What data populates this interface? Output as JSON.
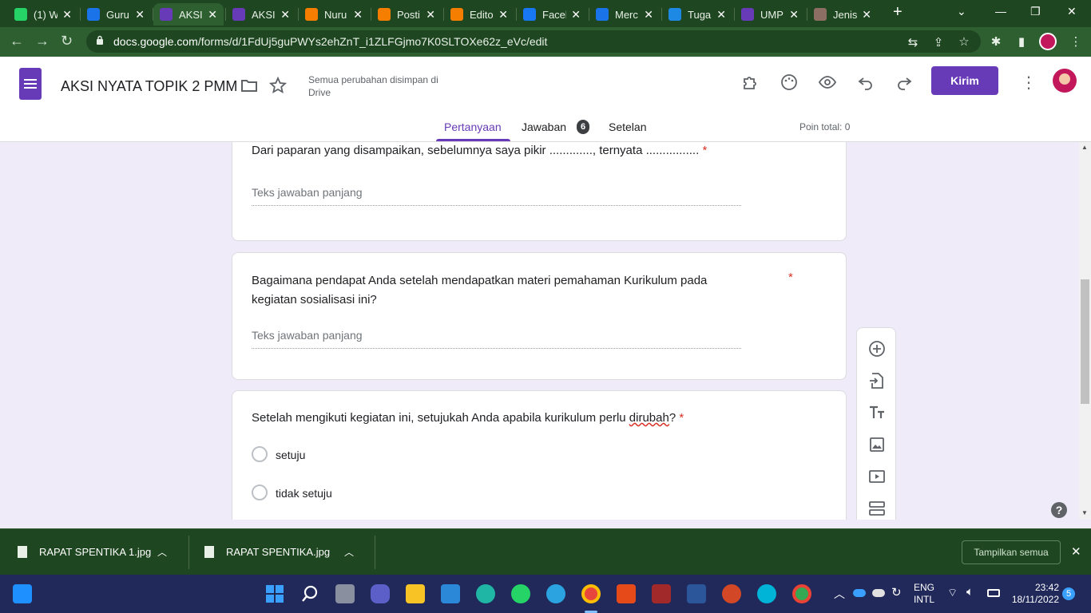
{
  "browser": {
    "tabs": [
      {
        "title": "(1) W",
        "icon": "whatsapp-icon",
        "color": "#25d366"
      },
      {
        "title": "Guru",
        "icon": "merdeka-icon",
        "color": "#1a73e8"
      },
      {
        "title": "AKSI",
        "icon": "forms-icon",
        "color": "#673ab7",
        "active": true
      },
      {
        "title": "AKSI",
        "icon": "forms-icon",
        "color": "#673ab7"
      },
      {
        "title": "Nuru",
        "icon": "blogger-icon",
        "color": "#f57d00"
      },
      {
        "title": "Posti",
        "icon": "blogger-icon",
        "color": "#f57d00"
      },
      {
        "title": "Edito",
        "icon": "blogger-icon",
        "color": "#f57d00"
      },
      {
        "title": "Facel",
        "icon": "facebook-icon",
        "color": "#1877f2"
      },
      {
        "title": "Merc",
        "icon": "merdeka-icon",
        "color": "#1a73e8"
      },
      {
        "title": "Tuga",
        "icon": "classroom-icon",
        "color": "#1e88e5"
      },
      {
        "title": "UMP",
        "icon": "forms-icon",
        "color": "#673ab7"
      },
      {
        "title": "Jenis",
        "icon": "site-icon",
        "color": "#8d6e63"
      }
    ],
    "url_host": "docs.google.com",
    "url_path": "/forms/d/1FdUj5guPWYs2ehZnT_i1ZLFGjmo7K0SLTOXe62z_eVc/edit"
  },
  "forms": {
    "title": "AKSI NYATA TOPIK 2 PMM",
    "save_status": "Semua perubahan disimpan di Drive",
    "send_label": "Kirim",
    "tabs": {
      "questions": "Pertanyaan",
      "responses": "Jawaban",
      "responses_count": "6",
      "settings": "Setelan"
    },
    "points": "Poin total: 0"
  },
  "questions": [
    {
      "text": "Dari paparan yang disampaikan, sebelumnya saya pikir ............., ternyata ................",
      "required": "*",
      "answer_placeholder": "Teks jawaban panjang"
    },
    {
      "text": "Bagaimana pendapat Anda setelah mendapatkan materi pemahaman Kurikulum pada kegiatan sosialisasi ini?",
      "required": "*",
      "answer_placeholder": "Teks jawaban panjang"
    },
    {
      "text_before": "Setelah mengikuti kegiatan ini, setujukah Anda apabila kurikulum perlu ",
      "text_misspelled": "dirubah",
      "text_after": "?",
      "required": "*",
      "options": [
        "setuju",
        "tidak setuju"
      ]
    }
  ],
  "help_label": "?",
  "downloads": {
    "items": [
      "RAPAT SPENTIKA 1.jpg",
      "RAPAT SPENTIKA.jpg"
    ],
    "show_all": "Tampilkan semua"
  },
  "taskbar": {
    "lang_line1": "ENG",
    "lang_line2": "INTL",
    "time": "23:42",
    "date": "18/11/2022",
    "notifications": "5"
  }
}
